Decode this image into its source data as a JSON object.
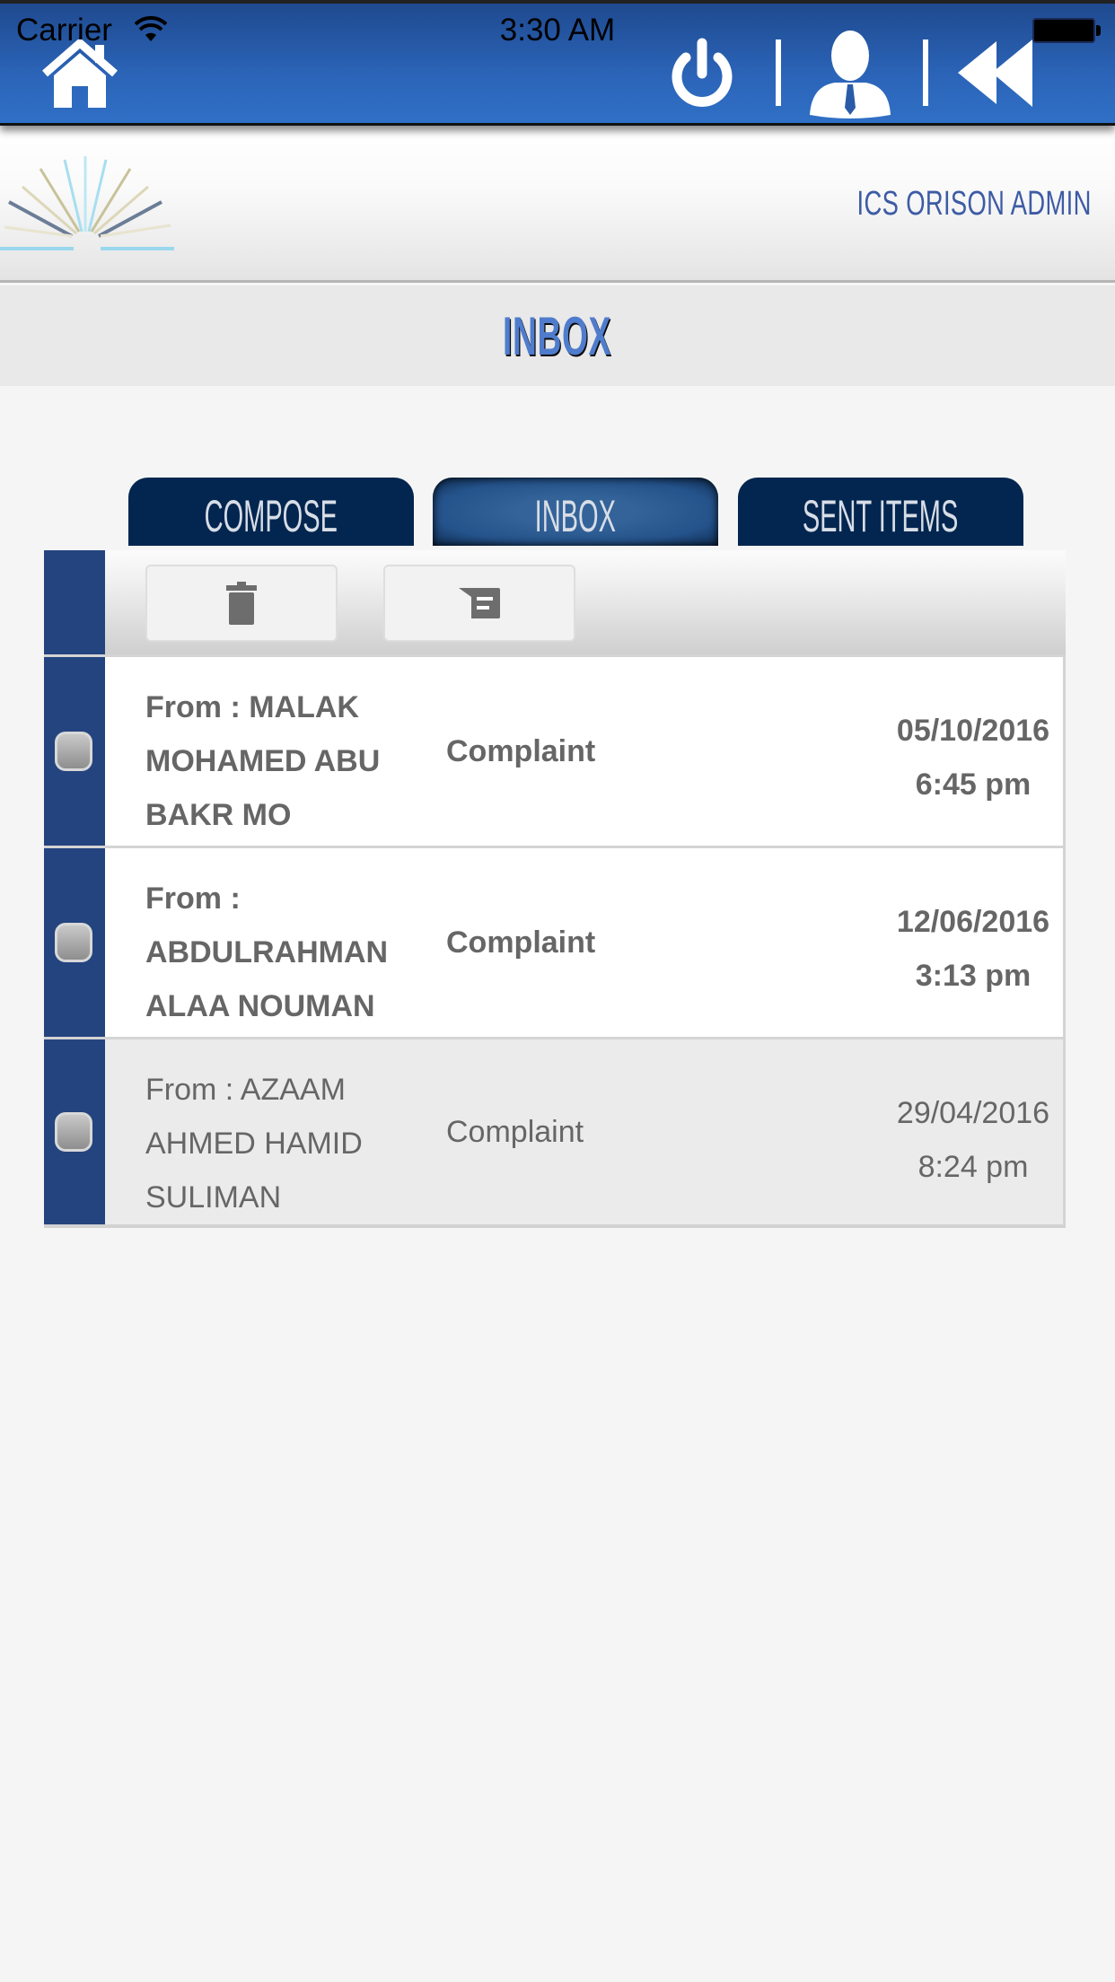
{
  "status_bar": {
    "carrier": "Carrier",
    "time": "3:30 AM",
    "wifi_icon": "wifi-icon",
    "battery_icon": "battery-icon"
  },
  "top_nav": {
    "home_icon": "home-icon",
    "power_icon": "power-icon",
    "profile_icon": "user-profile-icon",
    "back_icon": "rewind-back-icon"
  },
  "header": {
    "logo": "book-rays-logo",
    "admin_name": "ICS ORISON ADMIN"
  },
  "page": {
    "title": "INBOX"
  },
  "tabs": [
    {
      "label": "COMPOSE",
      "active": false
    },
    {
      "label": "INBOX",
      "active": true
    },
    {
      "label": "SENT ITEMS",
      "active": false
    }
  ],
  "toolbar": {
    "delete_icon": "trash-icon",
    "message_icon": "message-icon"
  },
  "messages": [
    {
      "from": "From : MALAK MOHAMED ABU BAKR MO",
      "subject": "Complaint",
      "date": "05/10/2016",
      "time": "6:45 pm",
      "unread": true
    },
    {
      "from": "From : ABDULRAHMAN ALAA NOUMAN",
      "subject": "Complaint",
      "date": "12/06/2016",
      "time": "3:13 pm",
      "unread": true
    },
    {
      "from": "From : AZAAM AHMED HAMID SULIMAN",
      "subject": "Complaint",
      "date": "29/04/2016",
      "time": "8:24 pm",
      "unread": false
    }
  ],
  "colors": {
    "topbar_blue": "#2b64b8",
    "tab_navy": "#022650",
    "side_bar_blue": "#24447f",
    "title_blue": "#4f7ccc",
    "admin_blue": "#3d5ba5",
    "text_gray": "#666666"
  }
}
